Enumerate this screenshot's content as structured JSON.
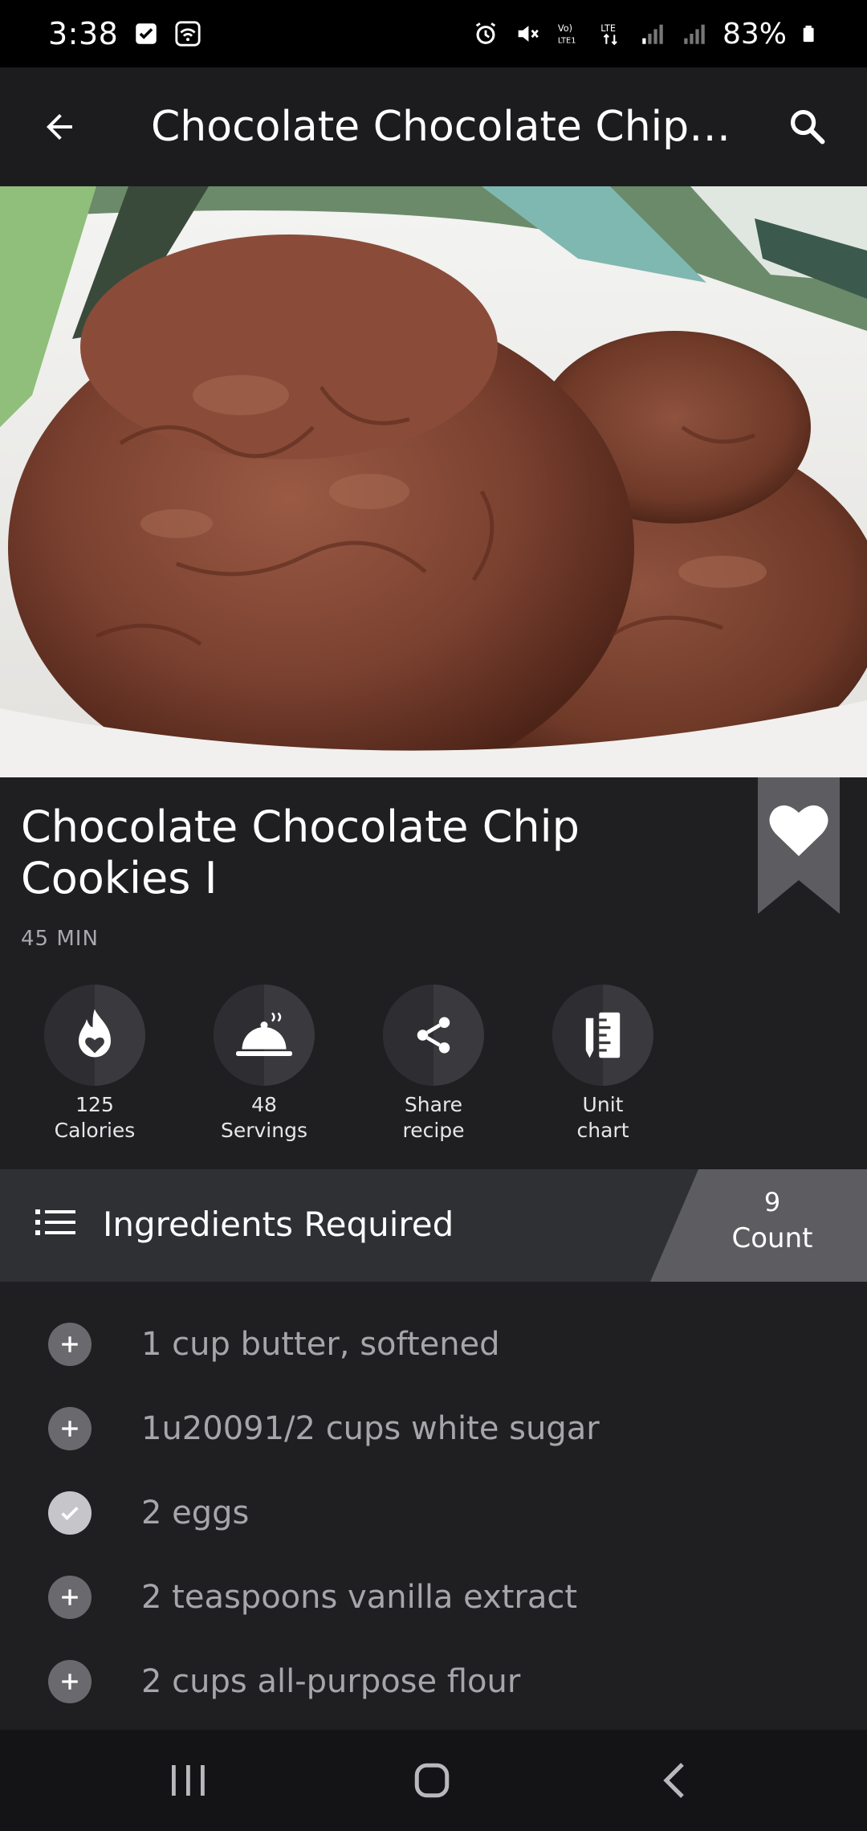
{
  "status_bar": {
    "time": "3:38",
    "battery": "83%",
    "network": "LTE"
  },
  "app_bar": {
    "title": "Chocolate Chocolate Chip Coo…"
  },
  "recipe": {
    "title": "Chocolate Chocolate Chip Cookies I",
    "time": "45 MIN",
    "favorited": true
  },
  "actions": [
    {
      "value": "125",
      "label": "Calories",
      "icon": "flame-heart-icon"
    },
    {
      "value": "48",
      "label": "Servings",
      "icon": "cloche-icon"
    },
    {
      "value": "Share",
      "label": "recipe",
      "icon": "share-icon"
    },
    {
      "value": "Unit",
      "label": "chart",
      "icon": "unit-chart-icon"
    }
  ],
  "ingredients": {
    "title": "Ingredients Required",
    "count": "9",
    "count_label": "Count",
    "items": [
      {
        "text": "1 cup butter, softened",
        "checked": false
      },
      {
        "text": "1u20091/2 cups white sugar",
        "checked": false
      },
      {
        "text": "2 eggs",
        "checked": true
      },
      {
        "text": "2 teaspoons vanilla extract",
        "checked": false
      },
      {
        "text": "2 cups all-purpose flour",
        "checked": false
      }
    ]
  },
  "colors": {
    "background": "#1f1f22",
    "header_bar": "#2f3034",
    "count_box": "#5d5d61",
    "ingredient_text": "#a6a6aa"
  }
}
